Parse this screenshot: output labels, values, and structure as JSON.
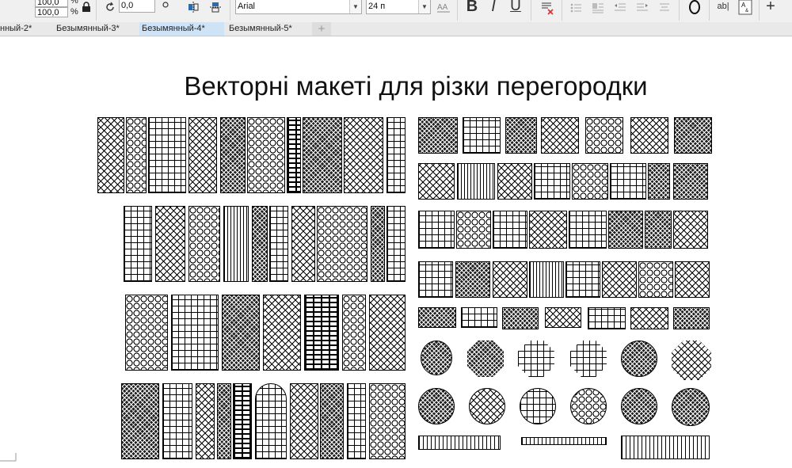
{
  "toolbar": {
    "scale_x": "100,0",
    "scale_y": "100,0",
    "percent_top": "%",
    "percent_bottom": "%",
    "rotation": "0,0",
    "font_name": "Arial",
    "font_size": "24 п",
    "bold_label": "B",
    "italic_label": "I",
    "underline_label": "U",
    "text_format_label": "ab|",
    "plus_label": "+"
  },
  "tabs": [
    {
      "label": "нный-2*"
    },
    {
      "label": "Безымянный-3*"
    },
    {
      "label": "Безымянный-4*"
    },
    {
      "label": "Безымянный-5*"
    }
  ],
  "new_tab_label": "+",
  "document": {
    "title": "Векторні макеті для різки перегородки"
  }
}
